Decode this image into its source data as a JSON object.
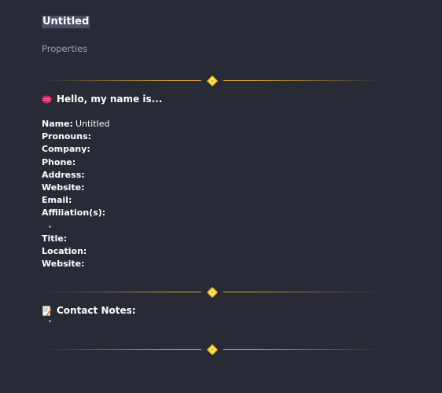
{
  "page": {
    "title": "Untitled",
    "properties_label": "Properties"
  },
  "section_intro": {
    "icon": "lips-emoji",
    "heading": "Hello, my name is..."
  },
  "fields": [
    {
      "label": "Name:",
      "value": "Untitled"
    },
    {
      "label": "Pronouns:",
      "value": ""
    },
    {
      "label": "Company:",
      "value": ""
    },
    {
      "label": "Phone:",
      "value": ""
    },
    {
      "label": "Address:",
      "value": ""
    },
    {
      "label": "Website:",
      "value": ""
    },
    {
      "label": "Email:",
      "value": ""
    },
    {
      "label": "Affiliation(s):",
      "value": ""
    }
  ],
  "fields_after": [
    {
      "label": "Title:",
      "value": ""
    },
    {
      "label": "Location:",
      "value": ""
    },
    {
      "label": "Website:",
      "value": ""
    }
  ],
  "section_notes": {
    "icon": "memo-emoji",
    "heading": "Contact Notes:"
  },
  "colors": {
    "background": "#282a36",
    "divider_gold": "#d4a03a",
    "gem_yellow": "#f5c518",
    "bullet": "#8b8fc0"
  }
}
